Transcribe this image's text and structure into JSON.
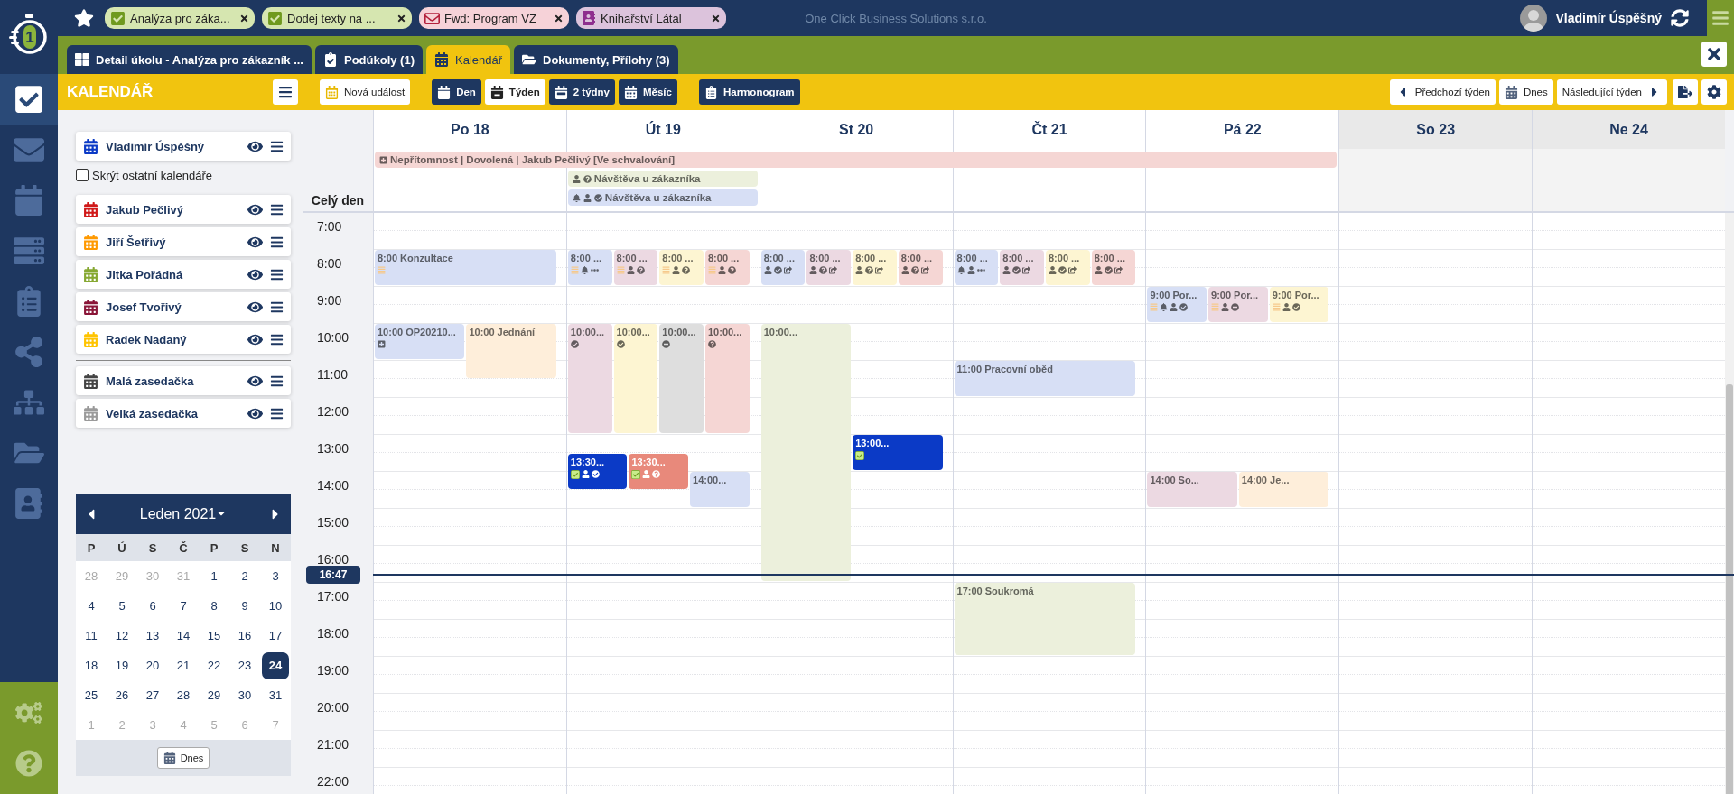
{
  "logo": {
    "digit": "1"
  },
  "rail": [
    {
      "selected": true
    },
    {
      "selected": false
    },
    {
      "selected": false
    },
    {
      "selected": false
    },
    {
      "selected": false
    },
    {
      "selected": false
    },
    {
      "selected": false
    },
    {
      "selected": false
    },
    {
      "selected": false
    }
  ],
  "open_items": [
    {
      "label": "Analýza pro záka...",
      "kind": "task"
    },
    {
      "label": "Dodej texty na ...",
      "kind": "task"
    },
    {
      "label": "Fwd: Program VZ",
      "kind": "mail"
    },
    {
      "label": "Knihařství Látal",
      "kind": "contact"
    }
  ],
  "company": "One Click Business Solutions s.r.o.",
  "user": {
    "name": "Vladimír Úspěšný"
  },
  "tabs": [
    {
      "label": "Detail úkolu - Analýza pro zákazník ...",
      "selected": false
    },
    {
      "label": "Podúkoly (1)",
      "selected": false
    },
    {
      "label": "Kalendář",
      "selected": true
    },
    {
      "label": "Dokumenty, Přílohy (3)",
      "selected": false
    }
  ],
  "toolbar": {
    "title": "KALENDÁŘ",
    "new_event": "Nová událost",
    "views": [
      {
        "label": "Den",
        "selected": false
      },
      {
        "label": "Týden",
        "selected": true
      },
      {
        "label": "2 týdny",
        "selected": false
      },
      {
        "label": "Měsíc",
        "selected": false
      }
    ],
    "gantt": "Harmonogram",
    "previous": "Předchozí týden",
    "today": "Dnes",
    "next": "Následující týden"
  },
  "calendars": {
    "mine": [
      {
        "name": "Vladimír Úspěšný",
        "color": "#0b3ac6"
      }
    ],
    "hide_others": {
      "label": "Skrýt ostatní kalendáře",
      "checked": false
    },
    "people": [
      {
        "name": "Jakub Pečlivý",
        "color": "#d01818"
      },
      {
        "name": "Jiří Šetřivý",
        "color": "#ff9900"
      },
      {
        "name": "Jitka Pořádná",
        "color": "#86a832"
      },
      {
        "name": "Josef Tvořivý",
        "color": "#8a1538"
      },
      {
        "name": "Radek Nadaný",
        "color": "#ffc400"
      }
    ],
    "rooms": [
      {
        "name": "Malá zasedačka",
        "color": "#444444"
      },
      {
        "name": "Velká zasedačka",
        "color": "#9a9a9a"
      }
    ]
  },
  "mini_calendar": {
    "month": "Leden 2021",
    "weekdays": [
      "P",
      "Ú",
      "S",
      "Č",
      "P",
      "S",
      "N"
    ],
    "days": [
      {
        "d": "28",
        "muted": true,
        "selected": false
      },
      {
        "d": "29",
        "muted": true,
        "selected": false
      },
      {
        "d": "30",
        "muted": true,
        "selected": false
      },
      {
        "d": "31",
        "muted": true,
        "selected": false
      },
      {
        "d": "1",
        "muted": false,
        "selected": false
      },
      {
        "d": "2",
        "muted": false,
        "selected": false
      },
      {
        "d": "3",
        "muted": false,
        "selected": false
      },
      {
        "d": "4",
        "muted": false,
        "selected": false
      },
      {
        "d": "5",
        "muted": false,
        "selected": false
      },
      {
        "d": "6",
        "muted": false,
        "selected": false
      },
      {
        "d": "7",
        "muted": false,
        "selected": false
      },
      {
        "d": "8",
        "muted": false,
        "selected": false
      },
      {
        "d": "9",
        "muted": false,
        "selected": false
      },
      {
        "d": "10",
        "muted": false,
        "selected": false
      },
      {
        "d": "11",
        "muted": false,
        "selected": false
      },
      {
        "d": "12",
        "muted": false,
        "selected": false
      },
      {
        "d": "13",
        "muted": false,
        "selected": false
      },
      {
        "d": "14",
        "muted": false,
        "selected": false
      },
      {
        "d": "15",
        "muted": false,
        "selected": false
      },
      {
        "d": "16",
        "muted": false,
        "selected": false
      },
      {
        "d": "17",
        "muted": false,
        "selected": false
      },
      {
        "d": "18",
        "muted": false,
        "selected": false
      },
      {
        "d": "19",
        "muted": false,
        "selected": false
      },
      {
        "d": "20",
        "muted": false,
        "selected": false
      },
      {
        "d": "21",
        "muted": false,
        "selected": false
      },
      {
        "d": "22",
        "muted": false,
        "selected": false
      },
      {
        "d": "23",
        "muted": false,
        "selected": false
      },
      {
        "d": "24",
        "muted": false,
        "selected": true
      },
      {
        "d": "25",
        "muted": false,
        "selected": false
      },
      {
        "d": "26",
        "muted": false,
        "selected": false
      },
      {
        "d": "27",
        "muted": false,
        "selected": false
      },
      {
        "d": "28",
        "muted": false,
        "selected": false
      },
      {
        "d": "29",
        "muted": false,
        "selected": false
      },
      {
        "d": "30",
        "muted": false,
        "selected": false
      },
      {
        "d": "31",
        "muted": false,
        "selected": false
      },
      {
        "d": "1",
        "muted": true,
        "selected": false
      },
      {
        "d": "2",
        "muted": true,
        "selected": false
      },
      {
        "d": "3",
        "muted": true,
        "selected": false
      },
      {
        "d": "4",
        "muted": true,
        "selected": false
      },
      {
        "d": "5",
        "muted": true,
        "selected": false
      },
      {
        "d": "6",
        "muted": true,
        "selected": false
      },
      {
        "d": "7",
        "muted": true,
        "selected": false
      }
    ],
    "today": "Dnes"
  },
  "week": {
    "all_day_label": "Celý den",
    "hours": [
      "7:00",
      "8:00",
      "9:00",
      "10:00",
      "11:00",
      "12:00",
      "13:00",
      "14:00",
      "15:00",
      "16:00",
      "17:00",
      "18:00",
      "19:00",
      "20:00",
      "21:00",
      "22:00"
    ],
    "now": "16:47",
    "days": [
      {
        "label": "Po 18",
        "weekend": false,
        "all_day": [
          {
            "title": "Nepřítomnost | Dovolená | Jakub Pečlivý [Ve schvalování]",
            "kind": "workweek",
            "color": "#f5d6d4",
            "icons": [
              {
                "kind": "away"
              }
            ]
          }
        ],
        "events": [
          {
            "title": "8:00 Konzultace",
            "kind": "hour",
            "color": "#d7dff5",
            "icons": [
              {
                "kind": "notes"
              }
            ]
          },
          {
            "title": "10:00 OP20210...",
            "kind": "hour",
            "color": "#d7dff5",
            "icons": [
              {
                "kind": "away"
              }
            ]
          },
          {
            "title": "10:00 Jednání",
            "kind": "hourhalf",
            "color": "#feeeda"
          }
        ]
      },
      {
        "label": "Út 19",
        "weekend": false,
        "all_day": [
          {
            "title": "Návštěva u zákazníka",
            "kind": "day",
            "color": "#ecf0dc",
            "icons": [
              {
                "kind": "person"
              },
              {
                "kind": "question"
              }
            ]
          },
          {
            "title": "Návštěva u zákazníka",
            "kind": "day",
            "color": "#d7dff5",
            "icons": [
              {
                "kind": "bell"
              },
              {
                "kind": "person"
              },
              {
                "kind": "check"
              }
            ]
          }
        ],
        "events": [
          {
            "title": "8:00 ...",
            "kind": "hour",
            "color": "#d7dff5",
            "icons": [
              {
                "kind": "notes"
              },
              {
                "kind": "bell"
              },
              {
                "kind": "more"
              }
            ]
          },
          {
            "title": "8:00 ...",
            "kind": "hour",
            "color": "#ecd9e2",
            "icons": [
              {
                "kind": "notes"
              },
              {
                "kind": "person"
              },
              {
                "kind": "question"
              }
            ]
          },
          {
            "title": "8:00 ...",
            "kind": "hour",
            "color": "#fdf5d2",
            "icons": [
              {
                "kind": "notes"
              },
              {
                "kind": "person"
              },
              {
                "kind": "question"
              }
            ]
          },
          {
            "title": "8:00 ...",
            "kind": "hour",
            "color": "#f5d6d4",
            "icons": [
              {
                "kind": "notes"
              },
              {
                "kind": "person"
              },
              {
                "kind": "question"
              }
            ]
          },
          {
            "title": "10:00...",
            "kind": "threehours",
            "color": "#ecd9e2",
            "icons": [
              {
                "kind": "check"
              }
            ]
          },
          {
            "title": "10:00...",
            "kind": "threehours",
            "color": "#fdf5d2",
            "icons": [
              {
                "kind": "check"
              }
            ]
          },
          {
            "title": "10:00...",
            "kind": "threehours",
            "color": "#dedede",
            "icons": [
              {
                "kind": "minus"
              }
            ]
          },
          {
            "title": "10:00...",
            "kind": "threehours",
            "color": "#f5d6d4",
            "icons": [
              {
                "kind": "question"
              }
            ]
          },
          {
            "title": "13:30...",
            "kind": "hour",
            "color": "#0b3ac6",
            "icons": [
              {
                "kind": "task"
              },
              {
                "kind": "person"
              },
              {
                "kind": "check"
              }
            ]
          },
          {
            "title": "13:30...",
            "kind": "hour",
            "color": "#e8897b",
            "icons": [
              {
                "kind": "task"
              },
              {
                "kind": "person"
              },
              {
                "kind": "question"
              }
            ]
          },
          {
            "title": "14:00...",
            "kind": "hour",
            "color": "#d7dff5"
          }
        ]
      },
      {
        "label": "St 20",
        "weekend": false,
        "events": [
          {
            "title": "8:00 ...",
            "kind": "hour",
            "color": "#d7dff5",
            "icons": [
              {
                "kind": "person"
              },
              {
                "kind": "check"
              },
              {
                "kind": "repeat"
              }
            ]
          },
          {
            "title": "8:00 ...",
            "kind": "hour",
            "color": "#ecd9e2",
            "icons": [
              {
                "kind": "person"
              },
              {
                "kind": "question"
              },
              {
                "kind": "repeat"
              }
            ]
          },
          {
            "title": "8:00 ...",
            "kind": "hour",
            "color": "#fdf5d2",
            "icons": [
              {
                "kind": "person"
              },
              {
                "kind": "question"
              },
              {
                "kind": "repeat"
              }
            ]
          },
          {
            "title": "8:00 ...",
            "kind": "hour",
            "color": "#f5d6d4",
            "icons": [
              {
                "kind": "person"
              },
              {
                "kind": "question"
              },
              {
                "kind": "repeat"
              }
            ]
          },
          {
            "title": "10:00...",
            "kind": "sevenhours",
            "color": "#ecf0dc"
          },
          {
            "title": "13:00...",
            "kind": "hour",
            "color": "#0b3ac6",
            "icons": [
              {
                "kind": "task"
              }
            ]
          }
        ]
      },
      {
        "label": "Čt 21",
        "weekend": false,
        "events": [
          {
            "title": "8:00 ...",
            "kind": "hour",
            "color": "#d7dff5",
            "icons": [
              {
                "kind": "bell"
              },
              {
                "kind": "person"
              },
              {
                "kind": "more"
              }
            ]
          },
          {
            "title": "8:00 ...",
            "kind": "hour",
            "color": "#ecd9e2",
            "icons": [
              {
                "kind": "person"
              },
              {
                "kind": "check"
              },
              {
                "kind": "repeat"
              }
            ]
          },
          {
            "title": "8:00 ...",
            "kind": "hour",
            "color": "#fdf5d2",
            "icons": [
              {
                "kind": "person"
              },
              {
                "kind": "check"
              },
              {
                "kind": "repeat"
              }
            ]
          },
          {
            "title": "8:00 ...",
            "kind": "hour",
            "color": "#f5d6d4",
            "icons": [
              {
                "kind": "person"
              },
              {
                "kind": "check"
              },
              {
                "kind": "repeat"
              }
            ]
          },
          {
            "title": "11:00 Pracovní oběd",
            "kind": "hour",
            "color": "#d7dff5"
          },
          {
            "title": "17:00 Soukromá",
            "kind": "twohours",
            "color": "#ecf0dc"
          }
        ]
      },
      {
        "label": "Pá 22",
        "weekend": false,
        "events": [
          {
            "title": "9:00 Por...",
            "kind": "hour",
            "color": "#d7dff5",
            "icons": [
              {
                "kind": "notes"
              },
              {
                "kind": "bell"
              },
              {
                "kind": "person"
              },
              {
                "kind": "check"
              }
            ]
          },
          {
            "title": "9:00 Por...",
            "kind": "hour",
            "color": "#ecd9e2",
            "icons": [
              {
                "kind": "notes"
              },
              {
                "kind": "person"
              },
              {
                "kind": "minus"
              }
            ]
          },
          {
            "title": "9:00 Por...",
            "kind": "hour",
            "color": "#fdf5d2",
            "icons": [
              {
                "kind": "notes"
              },
              {
                "kind": "person"
              },
              {
                "kind": "check"
              }
            ]
          },
          {
            "title": "14:00 So...",
            "kind": "hour",
            "color": "#ecd9e2"
          },
          {
            "title": "14:00 Je...",
            "kind": "hour",
            "color": "#feeeda"
          }
        ]
      },
      {
        "label": "So 23",
        "weekend": true
      },
      {
        "label": "Ne 24",
        "weekend": true
      }
    ]
  }
}
